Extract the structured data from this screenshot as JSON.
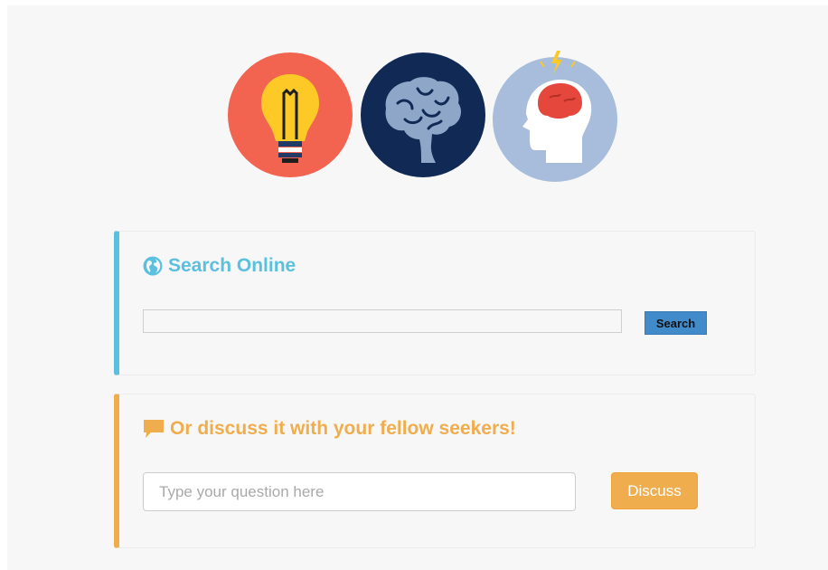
{
  "hero": {
    "icons": [
      "lightbulb-icon",
      "brain-icon",
      "head-brain-icon"
    ],
    "colors": {
      "lightbulb_bg": "#f26450",
      "brain_bg": "#112a55",
      "head_bg": "#a7bddb"
    }
  },
  "search": {
    "heading": "Search Online",
    "icon": "globe-icon",
    "input_value": "",
    "button_label": "Search",
    "accent": "#5bc0de"
  },
  "discuss": {
    "heading": "Or discuss it with your fellow seekers!",
    "icon": "comment-icon",
    "placeholder": "Type your question here",
    "button_label": "Discuss",
    "accent": "#f0ad4e"
  }
}
